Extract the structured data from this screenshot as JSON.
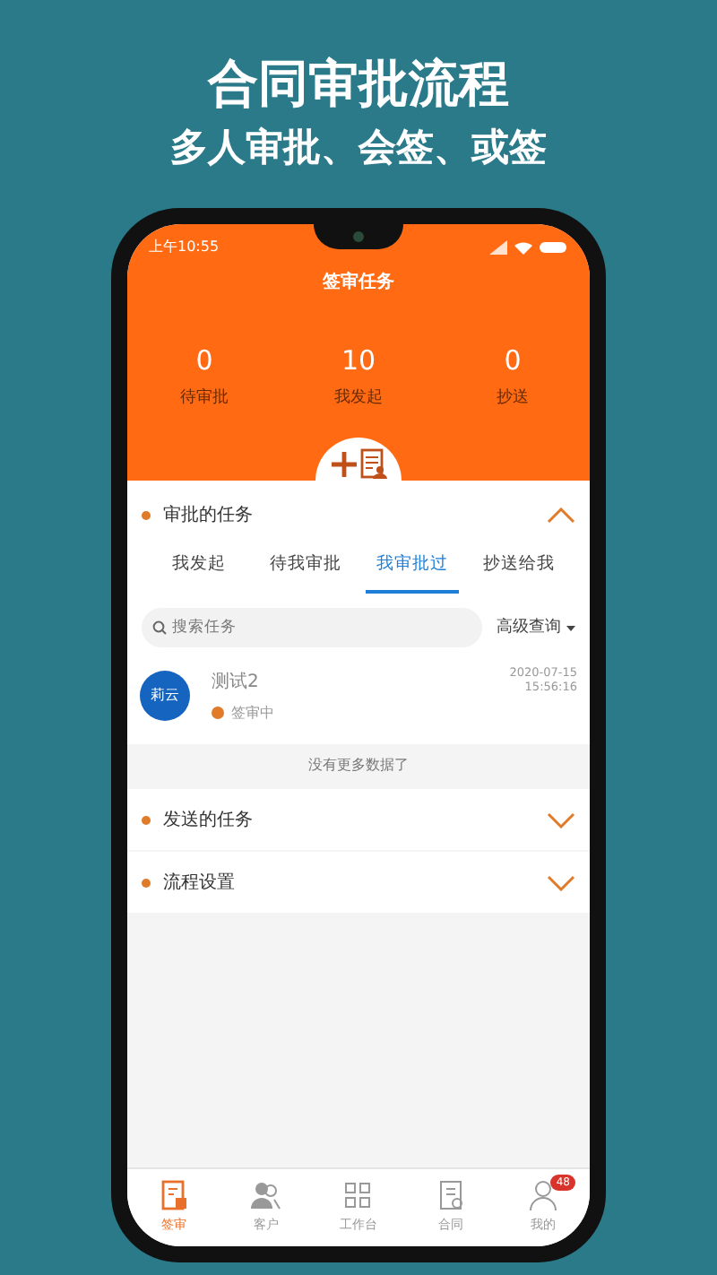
{
  "promo": {
    "title": "合同审批流程",
    "subtitle": "多人审批、会签、或签"
  },
  "status_bar": {
    "time": "上午10:55"
  },
  "header": {
    "title": "签审任务"
  },
  "stats": [
    {
      "value": "0",
      "label": "待审批"
    },
    {
      "value": "10",
      "label": "我发起"
    },
    {
      "value": "0",
      "label": "抄送"
    }
  ],
  "sections": [
    {
      "title": "审批的任务",
      "expanded": true,
      "tabs": [
        {
          "label": "我发起",
          "selected": false
        },
        {
          "label": "待我审批",
          "selected": false
        },
        {
          "label": "我审批过",
          "selected": true
        },
        {
          "label": "抄送给我",
          "selected": false
        }
      ],
      "search": {
        "placeholder": "搜索任务"
      },
      "filter": "高级查询",
      "tasks": [
        {
          "avatar": "莉云",
          "title": "测试2",
          "status": "签审中",
          "date": "2020-07-15",
          "time": "15:56:16"
        }
      ],
      "end_message": "没有更多数据了"
    },
    {
      "title": "发送的任务",
      "expanded": false
    },
    {
      "title": "流程设置",
      "expanded": false
    }
  ],
  "tab_bar": [
    {
      "label": "签审",
      "selected": true,
      "kind": "doc"
    },
    {
      "label": "客户",
      "selected": false,
      "kind": "people"
    },
    {
      "label": "工作台",
      "selected": false,
      "kind": "grid"
    },
    {
      "label": "合同",
      "selected": false,
      "kind": "contract"
    },
    {
      "label": "我的",
      "selected": false,
      "kind": "person",
      "badge": "48"
    }
  ]
}
